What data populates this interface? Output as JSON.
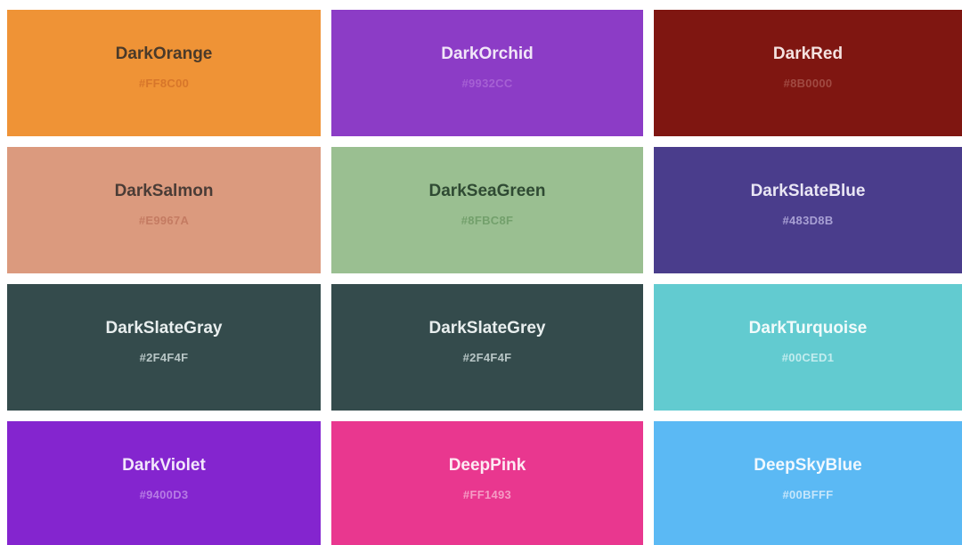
{
  "swatches": [
    {
      "name": "DarkOrange",
      "code": "#FF8C00",
      "color": "#FF8C00"
    },
    {
      "name": "DarkOrchid",
      "code": "#9932CC",
      "color": "#9932CC"
    },
    {
      "name": "DarkRed",
      "code": "#8B0000",
      "color": "#8B0000"
    },
    {
      "name": "DarkSalmon",
      "code": "#E9967A",
      "color": "#E9967A"
    },
    {
      "name": "DarkSeaGreen",
      "code": "#8FBC8F",
      "color": "#8FBC8F"
    },
    {
      "name": "DarkSlateBlue",
      "code": "#483D8B",
      "color": "#483D8B"
    },
    {
      "name": "DarkSlateGray",
      "code": "#2F4F4F",
      "color": "#2F4F4F"
    },
    {
      "name": "DarkSlateGrey",
      "code": "#2F4F4F",
      "color": "#2F4F4F"
    },
    {
      "name": "DarkTurquoise",
      "code": "#00CED1",
      "color": "#00CED1"
    },
    {
      "name": "DarkViolet",
      "code": "#9400D3",
      "color": "#9400D3"
    },
    {
      "name": "DeepPink",
      "code": "#FF1493",
      "color": "#FF1493"
    },
    {
      "name": "DeepSkyBlue",
      "code": "#00BFFF",
      "color": "#00BFFF"
    }
  ]
}
